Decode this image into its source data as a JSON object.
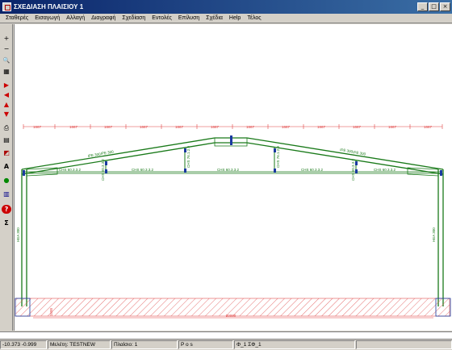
{
  "window": {
    "title": "ΣΧΕΔΙΑΣΗ ΠΛΑΙΣΙΟΥ 1",
    "min": "_",
    "max": "□",
    "close": "×"
  },
  "menu": [
    "Σταθερές",
    "Εισαγωγή",
    "Αλλαγή",
    "Διαγραφή",
    "Σχεδίαση",
    "Εντολές",
    "Επίλυση",
    "Σχέδια",
    "Help",
    "Τέλος"
  ],
  "toolbar": {
    "icons": [
      "plus-icon",
      "minus-icon",
      "zoom-icon",
      "window-icon",
      "arrow-right-icon",
      "arrow-left-icon",
      "arrow-up-icon",
      "arrow-down-icon",
      "print-icon",
      "calculator-icon",
      "palette-icon",
      "text-icon",
      "color-wheel-icon",
      "chart-icon",
      "help-icon",
      "sigma-icon"
    ],
    "glyphs": [
      "+",
      "−",
      "🔍",
      "▦",
      "▶",
      "◀",
      "▲",
      "▼",
      "⎙",
      "▤",
      "◩",
      "A",
      "●",
      "▥",
      "?",
      "Σ"
    ]
  },
  "drawing": {
    "spans": [
      "1667",
      "1667",
      "1667",
      "1667",
      "1667",
      "1667",
      "1667",
      "1667",
      "1667",
      "1667",
      "1667",
      "1667"
    ],
    "rafter_left": "IPE 300",
    "rafter_left_dup": "IPE 300",
    "rafter_right": "IPE 300",
    "rafter_right_dup": "IPE 300",
    "tie_labels": [
      "CHS 60.3.3.2",
      "CHS 60.3.3.2",
      "CHS 60.3.3.2",
      "CHS 60.3.3.2",
      "CHS 60.3.3.2"
    ],
    "post_labels": [
      "CHS 60.3.3.2",
      "CHS 76.1.2.9",
      "CHS 76.1.2.9",
      "CHS 60.3.3.2"
    ],
    "column_left": "HEA 300",
    "column_right": "HEA 300",
    "total_width": "20000",
    "base_height": "1500"
  },
  "status": {
    "coords": "-10.373 -0.999",
    "project": "Μελέτη: TESTNEW",
    "frame": "Πλαίσιο: 1",
    "mode": "P o s",
    "phase": "Φ_1 ΣΦ_1"
  }
}
